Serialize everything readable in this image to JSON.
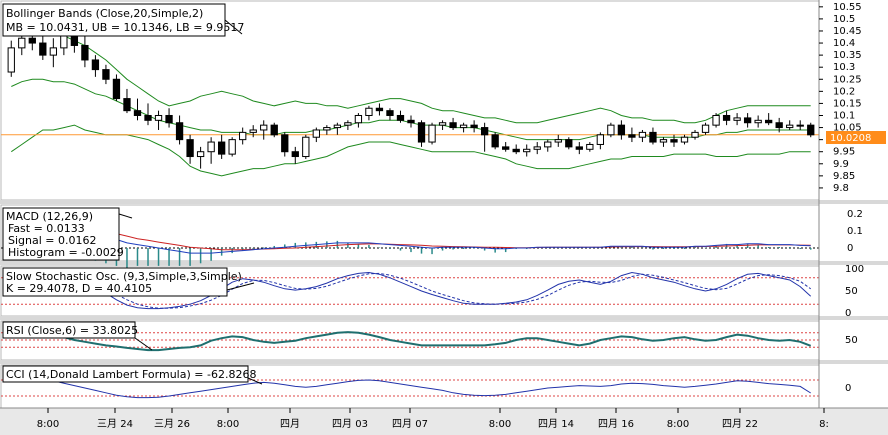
{
  "colors": {
    "bg": "#ffffff",
    "panel_border": "#b8b8b8",
    "separator": "#a8a8a8",
    "bb_line": "#1f8a1f",
    "candle": "#000000",
    "macd_fast": "#1f3fbf",
    "macd_signal": "#cc2222",
    "histogram": "#2a8a8a",
    "stoch_k": "#2233aa",
    "stoch_d": "#2233aa",
    "rsi": "#1f6f6f",
    "cci": "#2233aa",
    "ref_line": "#dd4444",
    "price_marker": "#ff8c1a",
    "price_line": "#ff9933"
  },
  "panels": {
    "bollinger": {
      "title": "Bollinger Bands (Close,20,Simple,2)",
      "values": "MB = 10.0431, UB = 10.1346, LB = 9.9517",
      "ticks": [
        "10.55",
        "10.5",
        "10.45",
        "10.4",
        "10.35",
        "10.3",
        "10.25",
        "10.2",
        "10.15",
        "10.1",
        "10.05",
        "10",
        "9.95",
        "9.9",
        "9.85",
        "9.8"
      ],
      "last_price": "10.0208"
    },
    "macd": {
      "title": "MACD (12,26,9)",
      "fast": "Fast = 0.0133",
      "signal": "Signal = 0.0162",
      "histogram": "Histogram = -0.0029",
      "ticks": [
        "0.2",
        "0.1",
        "0"
      ]
    },
    "stoch": {
      "title": "Slow Stochastic Osc. (9,3,Simple,3,Simple)",
      "values": "K = 29.4078, D = 40.4105",
      "ticks": [
        "100",
        "50",
        "0"
      ]
    },
    "rsi": {
      "title": "RSI (Close,6) = 33.8025",
      "ticks": [
        "50"
      ]
    },
    "cci": {
      "title": "CCI (14,Donald Lambert Formula) = -62.8268",
      "ticks": [
        "0"
      ]
    }
  },
  "x_axis": {
    "labels": [
      "8:00",
      "三月 24",
      "三月 26",
      "8:00",
      "四月",
      "四月 03",
      "四月 07",
      "8:00",
      "四月 14",
      "四月 16",
      "8:00",
      "四月 22",
      "8:"
    ]
  },
  "chart_data": {
    "type": "candlestick",
    "ylim": [
      9.75,
      10.57
    ],
    "candles": [
      [
        10.28,
        10.41,
        10.26,
        10.38
      ],
      [
        10.38,
        10.46,
        10.35,
        10.42
      ],
      [
        10.42,
        10.48,
        10.37,
        10.4
      ],
      [
        10.4,
        10.45,
        10.33,
        10.35
      ],
      [
        10.35,
        10.42,
        10.3,
        10.38
      ],
      [
        10.38,
        10.45,
        10.35,
        10.43
      ],
      [
        10.43,
        10.45,
        10.36,
        10.39
      ],
      [
        10.39,
        10.44,
        10.3,
        10.33
      ],
      [
        10.33,
        10.35,
        10.26,
        10.29
      ],
      [
        10.29,
        10.31,
        10.23,
        10.25
      ],
      [
        10.25,
        10.27,
        10.16,
        10.17
      ],
      [
        10.17,
        10.21,
        10.11,
        10.12
      ],
      [
        10.12,
        10.17,
        10.08,
        10.1
      ],
      [
        10.1,
        10.15,
        10.06,
        10.08
      ],
      [
        10.08,
        10.12,
        10.04,
        10.1
      ],
      [
        10.1,
        10.13,
        10.05,
        10.07
      ],
      [
        10.07,
        10.1,
        9.98,
        10.0
      ],
      [
        10.0,
        10.02,
        9.9,
        9.93
      ],
      [
        9.93,
        9.97,
        9.88,
        9.95
      ],
      [
        9.95,
        10.01,
        9.9,
        9.99
      ],
      [
        9.99,
        10.02,
        9.92,
        9.94
      ],
      [
        9.94,
        10.01,
        9.93,
        10.0
      ],
      [
        10.0,
        10.05,
        9.98,
        10.03
      ],
      [
        10.03,
        10.06,
        10.01,
        10.04
      ],
      [
        10.04,
        10.08,
        10.0,
        10.06
      ],
      [
        10.06,
        10.07,
        10.01,
        10.02
      ],
      [
        10.02,
        10.03,
        9.93,
        9.95
      ],
      [
        9.95,
        9.97,
        9.9,
        9.93
      ],
      [
        9.93,
        10.02,
        9.92,
        10.01
      ],
      [
        10.01,
        10.05,
        9.99,
        10.04
      ],
      [
        10.04,
        10.06,
        10.02,
        10.05
      ],
      [
        10.05,
        10.07,
        10.02,
        10.06
      ],
      [
        10.06,
        10.08,
        10.04,
        10.07
      ],
      [
        10.07,
        10.11,
        10.05,
        10.1
      ],
      [
        10.1,
        10.14,
        10.08,
        10.13
      ],
      [
        10.13,
        10.15,
        10.1,
        10.12
      ],
      [
        10.12,
        10.13,
        10.08,
        10.1
      ],
      [
        10.1,
        10.12,
        10.07,
        10.08
      ],
      [
        10.08,
        10.1,
        10.05,
        10.07
      ],
      [
        10.07,
        10.08,
        9.97,
        9.99
      ],
      [
        9.99,
        10.07,
        9.98,
        10.06
      ],
      [
        10.06,
        10.08,
        10.04,
        10.07
      ],
      [
        10.07,
        10.09,
        10.04,
        10.05
      ],
      [
        10.05,
        10.07,
        10.03,
        10.06
      ],
      [
        10.06,
        10.08,
        10.03,
        10.05
      ],
      [
        10.05,
        10.07,
        9.95,
        10.02
      ],
      [
        10.02,
        10.03,
        9.96,
        9.97
      ],
      [
        9.97,
        9.99,
        9.95,
        9.96
      ],
      [
        9.96,
        9.98,
        9.94,
        9.95
      ],
      [
        9.95,
        9.98,
        9.93,
        9.96
      ],
      [
        9.96,
        9.99,
        9.94,
        9.97
      ],
      [
        9.97,
        10.0,
        9.95,
        9.99
      ],
      [
        9.99,
        10.02,
        9.97,
        10.0
      ],
      [
        10.0,
        10.01,
        9.96,
        9.97
      ],
      [
        9.97,
        9.99,
        9.94,
        9.96
      ],
      [
        9.96,
        9.99,
        9.95,
        9.98
      ],
      [
        9.98,
        10.03,
        9.96,
        10.02
      ],
      [
        10.02,
        10.07,
        10.01,
        10.06
      ],
      [
        10.06,
        10.08,
        10.0,
        10.02
      ],
      [
        10.02,
        10.05,
        9.99,
        10.01
      ],
      [
        10.01,
        10.04,
        9.99,
        10.03
      ],
      [
        10.03,
        10.05,
        9.98,
        9.99
      ],
      [
        9.99,
        10.01,
        9.97,
        10.0
      ],
      [
        10.0,
        10.02,
        9.97,
        9.99
      ],
      [
        9.99,
        10.02,
        9.98,
        10.01
      ],
      [
        10.01,
        10.04,
        10.0,
        10.03
      ],
      [
        10.03,
        10.07,
        10.02,
        10.06
      ],
      [
        10.06,
        10.11,
        10.05,
        10.1
      ],
      [
        10.1,
        10.12,
        10.06,
        10.08
      ],
      [
        10.08,
        10.11,
        10.06,
        10.09
      ],
      [
        10.09,
        10.11,
        10.05,
        10.07
      ],
      [
        10.07,
        10.1,
        10.05,
        10.08
      ],
      [
        10.08,
        10.11,
        10.06,
        10.07
      ],
      [
        10.07,
        10.09,
        10.03,
        10.05
      ],
      [
        10.05,
        10.08,
        10.04,
        10.06
      ],
      [
        10.06,
        10.08,
        10.04,
        10.06
      ],
      [
        10.06,
        10.07,
        10.01,
        10.02
      ]
    ],
    "bb_upper": [
      10.5,
      10.49,
      10.48,
      10.46,
      10.45,
      10.43,
      10.41,
      10.39,
      10.36,
      10.33,
      10.29,
      10.25,
      10.22,
      10.19,
      10.16,
      10.14,
      10.15,
      10.16,
      10.18,
      10.19,
      10.2,
      10.19,
      10.18,
      10.16,
      10.15,
      10.14,
      10.15,
      10.16,
      10.15,
      10.15,
      10.14,
      10.14,
      10.13,
      10.14,
      10.15,
      10.16,
      10.17,
      10.17,
      10.16,
      10.15,
      10.13,
      10.12,
      10.12,
      10.11,
      10.1,
      10.09,
      10.09,
      10.08,
      10.07,
      10.07,
      10.07,
      10.08,
      10.09,
      10.1,
      10.11,
      10.12,
      10.13,
      10.12,
      10.1,
      10.09,
      10.09,
      10.08,
      10.08,
      10.08,
      10.07,
      10.07,
      10.08,
      10.1,
      10.12,
      10.13,
      10.14,
      10.14,
      10.14,
      10.14,
      10.14,
      10.14,
      10.14
    ],
    "bb_middle": [
      10.22,
      10.24,
      10.25,
      10.25,
      10.24,
      10.24,
      10.23,
      10.21,
      10.19,
      10.18,
      10.16,
      10.14,
      10.12,
      10.1,
      10.08,
      10.07,
      10.06,
      10.05,
      10.04,
      10.04,
      10.03,
      10.03,
      10.03,
      10.02,
      10.02,
      10.02,
      10.03,
      10.03,
      10.03,
      10.04,
      10.04,
      10.05,
      10.06,
      10.07,
      10.07,
      10.08,
      10.08,
      10.08,
      10.07,
      10.06,
      10.06,
      10.06,
      10.05,
      10.05,
      10.05,
      10.04,
      10.03,
      10.02,
      10.01,
      10.0,
      10.0,
      10.0,
      10.0,
      10.0,
      10.0,
      10.01,
      10.02,
      10.02,
      10.02,
      10.02,
      10.02,
      10.01,
      10.01,
      10.01,
      10.01,
      10.01,
      10.02,
      10.02,
      10.03,
      10.03,
      10.04,
      10.04,
      10.04,
      10.04,
      10.04,
      10.04,
      10.04
    ],
    "bb_lower": [
      9.95,
      9.98,
      10.01,
      10.04,
      10.04,
      10.05,
      10.06,
      10.04,
      10.03,
      10.02,
      10.02,
      10.02,
      10.01,
      10.0,
      9.98,
      9.96,
      9.93,
      9.89,
      9.87,
      9.86,
      9.85,
      9.86,
      9.87,
      9.88,
      9.88,
      9.89,
      9.9,
      9.9,
      9.91,
      9.92,
      9.93,
      9.95,
      9.97,
      9.98,
      9.99,
      9.99,
      9.99,
      9.98,
      9.97,
      9.96,
      9.95,
      9.95,
      9.95,
      9.95,
      9.95,
      9.94,
      9.93,
      9.92,
      9.9,
      9.89,
      9.88,
      9.88,
      9.88,
      9.88,
      9.89,
      9.9,
      9.91,
      9.92,
      9.92,
      9.93,
      9.93,
      9.93,
      9.93,
      9.94,
      9.94,
      9.94,
      9.94,
      9.93,
      9.93,
      9.93,
      9.94,
      9.94,
      9.94,
      9.94,
      9.95,
      9.95,
      9.95
    ],
    "macd_fast": [
      0.19,
      0.19,
      0.18,
      0.17,
      0.16,
      0.15,
      0.13,
      0.11,
      0.09,
      0.07,
      0.05,
      0.03,
      0.02,
      0.01,
      0.0,
      -0.01,
      -0.02,
      -0.03,
      -0.03,
      -0.03,
      -0.025,
      -0.02,
      -0.015,
      -0.01,
      -0.005,
      0.0,
      0.005,
      0.01,
      0.015,
      0.02,
      0.025,
      0.03,
      0.03,
      0.03,
      0.03,
      0.025,
      0.02,
      0.015,
      0.01,
      0.005,
      0.0,
      0.005,
      0.005,
      0.005,
      0.005,
      0.0,
      -0.005,
      -0.005,
      0.0,
      0.0,
      0.005,
      0.005,
      0.005,
      0.005,
      0.005,
      0.005,
      0.005,
      0.01,
      0.01,
      0.01,
      0.01,
      0.005,
      0.005,
      0.005,
      0.005,
      0.01,
      0.01,
      0.015,
      0.02,
      0.02,
      0.025,
      0.025,
      0.02,
      0.02,
      0.02,
      0.015,
      0.013
    ],
    "macd_signal": [
      0.19,
      0.185,
      0.18,
      0.17,
      0.16,
      0.15,
      0.14,
      0.13,
      0.115,
      0.1,
      0.085,
      0.07,
      0.055,
      0.045,
      0.035,
      0.025,
      0.015,
      0.005,
      0.0,
      -0.005,
      -0.01,
      -0.01,
      -0.01,
      -0.008,
      -0.006,
      -0.004,
      -0.002,
      0.0,
      0.004,
      0.008,
      0.012,
      0.016,
      0.02,
      0.022,
      0.024,
      0.024,
      0.022,
      0.02,
      0.018,
      0.016,
      0.012,
      0.01,
      0.008,
      0.007,
      0.006,
      0.005,
      0.004,
      0.003,
      0.002,
      0.002,
      0.003,
      0.004,
      0.004,
      0.004,
      0.004,
      0.004,
      0.005,
      0.006,
      0.007,
      0.008,
      0.008,
      0.008,
      0.007,
      0.007,
      0.007,
      0.008,
      0.009,
      0.01,
      0.012,
      0.014,
      0.016,
      0.018,
      0.018,
      0.018,
      0.018,
      0.017,
      0.0162
    ],
    "stoch_k": [
      95,
      92,
      90,
      88,
      85,
      82,
      78,
      70,
      60,
      45,
      30,
      18,
      12,
      10,
      10,
      12,
      15,
      20,
      28,
      40,
      55,
      70,
      78,
      75,
      70,
      62,
      55,
      52,
      55,
      60,
      68,
      78,
      85,
      90,
      92,
      88,
      80,
      70,
      60,
      50,
      42,
      35,
      28,
      22,
      20,
      20,
      20,
      22,
      25,
      30,
      40,
      52,
      65,
      72,
      75,
      70,
      65,
      72,
      85,
      92,
      88,
      80,
      75,
      70,
      62,
      55,
      50,
      55,
      65,
      78,
      88,
      90,
      85,
      80,
      75,
      60,
      38
    ],
    "stoch_d": [
      94,
      93,
      91,
      89,
      86,
      83,
      80,
      74,
      66,
      55,
      42,
      30,
      20,
      14,
      11,
      11,
      12,
      16,
      21,
      29,
      40,
      54,
      67,
      74,
      74,
      69,
      62,
      56,
      54,
      56,
      61,
      69,
      77,
      84,
      89,
      90,
      86,
      79,
      70,
      60,
      50,
      42,
      35,
      28,
      23,
      21,
      20,
      21,
      22,
      25,
      31,
      40,
      52,
      63,
      70,
      72,
      70,
      69,
      74,
      83,
      88,
      86,
      81,
      75,
      69,
      62,
      56,
      53,
      56,
      66,
      77,
      85,
      87,
      85,
      80,
      72,
      55
    ],
    "rsi": [
      80,
      82,
      78,
      72,
      65,
      58,
      50,
      45,
      40,
      35,
      32,
      28,
      25,
      22,
      22,
      25,
      28,
      30,
      35,
      48,
      55,
      60,
      58,
      50,
      45,
      42,
      45,
      48,
      55,
      60,
      65,
      70,
      72,
      70,
      65,
      58,
      50,
      45,
      40,
      35,
      35,
      35,
      35,
      35,
      35,
      35,
      38,
      42,
      50,
      55,
      55,
      50,
      45,
      40,
      35,
      40,
      50,
      55,
      60,
      58,
      52,
      48,
      50,
      55,
      58,
      52,
      48,
      50,
      58,
      65,
      62,
      55,
      50,
      48,
      50,
      45,
      34
    ],
    "cci": [
      180,
      170,
      150,
      120,
      90,
      60,
      30,
      0,
      -30,
      -60,
      -90,
      -110,
      -120,
      -120,
      -115,
      -100,
      -80,
      -60,
      -40,
      -20,
      0,
      20,
      40,
      60,
      70,
      60,
      40,
      20,
      10,
      20,
      40,
      60,
      80,
      95,
      100,
      90,
      70,
      50,
      30,
      10,
      -10,
      -30,
      -60,
      -80,
      -90,
      -95,
      -90,
      -80,
      -60,
      -40,
      -20,
      0,
      10,
      20,
      30,
      25,
      20,
      30,
      50,
      60,
      55,
      45,
      30,
      20,
      10,
      20,
      35,
      50,
      70,
      90,
      85,
      70,
      55,
      45,
      35,
      20,
      -62.8
    ]
  }
}
